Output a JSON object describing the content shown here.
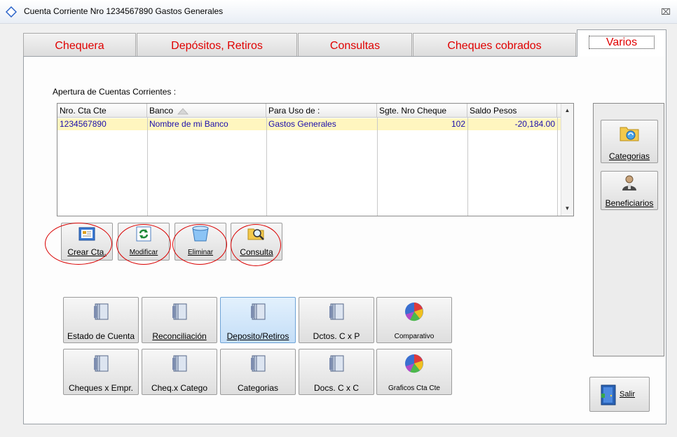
{
  "window": {
    "title": "Cuenta Corriente Nro 1234567890 Gastos Generales",
    "close_glyph": "⌧"
  },
  "tabs": [
    {
      "label": "Chequera"
    },
    {
      "label": "Depósitos, Retiros"
    },
    {
      "label": "Consultas"
    },
    {
      "label": "Cheques cobrados"
    },
    {
      "label": "Varios",
      "active": true
    }
  ],
  "section_label": "Apertura de Cuentas Corrientes :",
  "table": {
    "columns": [
      "Nro. Cta Cte",
      "Banco",
      "Para Uso de :",
      "Sgte. Nro Cheque",
      "Saldo Pesos"
    ],
    "sorted_by": "Banco",
    "rows": [
      {
        "nro": "1234567890",
        "banco": "Nombre de mi Banco",
        "uso": "Gastos Generales",
        "cheque": "102",
        "saldo": "-20,184.00"
      }
    ]
  },
  "account_buttons": {
    "crear": "Crear Cta.",
    "modificar": "Modificar",
    "eliminar": "Eliminar",
    "consulta": "Consulta"
  },
  "report_buttons": {
    "estado": "Estado de Cuenta",
    "reconciliacion": "Reconciliación",
    "deposito": "Deposito/Retiros",
    "dctos": "Dctos. C x P",
    "comparativo": "Comparativo",
    "cheques_empr": "Cheques x Empr.",
    "cheq_catego": "Cheq.x Catego",
    "categorias": "Categorias",
    "docs": "Docs. C x C",
    "graficos": "Graficos Cta Cte"
  },
  "side_buttons": {
    "categorias": "Categorias",
    "beneficiarios": "Beneficiarios"
  },
  "exit_button": "Salir",
  "colors": {
    "tab_text": "#e00000",
    "row_highlight": "#fff6bf",
    "row_text": "#1a0dab",
    "annotation_circle": "#d90000",
    "active_button": "#cfe6fb"
  }
}
